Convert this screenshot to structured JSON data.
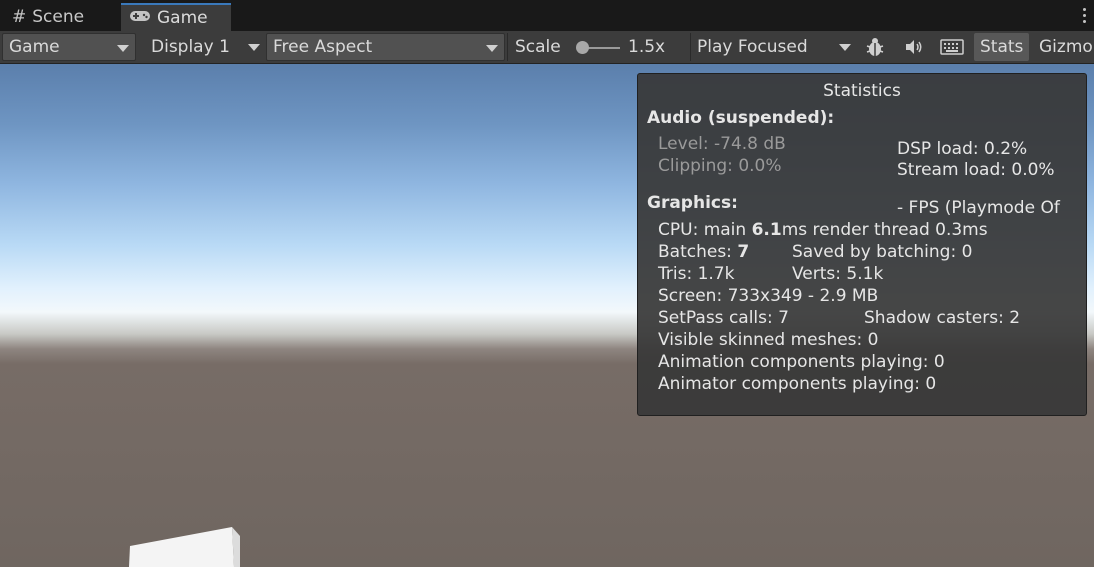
{
  "tabs": [
    {
      "label": "Scene",
      "icon": "hash-icon"
    },
    {
      "label": "Game",
      "icon": "gamepad-icon"
    }
  ],
  "toolbar": {
    "game_dropdown": "Game",
    "display_dropdown": "Display 1",
    "aspect_dropdown": "Free Aspect",
    "scale_label": "Scale",
    "scale_value": "1.5x",
    "scale_fraction": 0.1,
    "play_mode_dropdown": "Play Focused",
    "stats_label": "Stats",
    "gizmos_label": "Gizmo"
  },
  "stats": {
    "title": "Statistics",
    "audio_header": "Audio (suspended):",
    "level": "Level: -74.8 dB",
    "clipping": "Clipping: 0.0%",
    "dsp_load": "DSP load: 0.2%",
    "stream_load": "Stream load: 0.0%",
    "graphics_header": "Graphics:",
    "fps": "- FPS (Playmode Of",
    "cpu_prefix": "CPU: main ",
    "cpu_main": "6.1",
    "cpu_suffix": "ms  render thread 0.3ms",
    "batches_prefix": "Batches: ",
    "batches": "7",
    "saved_by_batching": "Saved by batching: 0",
    "tris": "Tris: 1.7k",
    "verts": "Verts: 5.1k",
    "screen": "Screen: 733x349 - 2.9 MB",
    "setpass": "SetPass calls: 7",
    "shadow_casters": "Shadow casters: 2",
    "skinned": "Visible skinned meshes: 0",
    "animation": "Animation components playing: 0",
    "animator": "Animator components playing: 0"
  },
  "colors": {
    "active_tab_accent": "#3a79bb",
    "toolbar_bg": "#3c3c3c",
    "panel_bg": "#383838"
  }
}
